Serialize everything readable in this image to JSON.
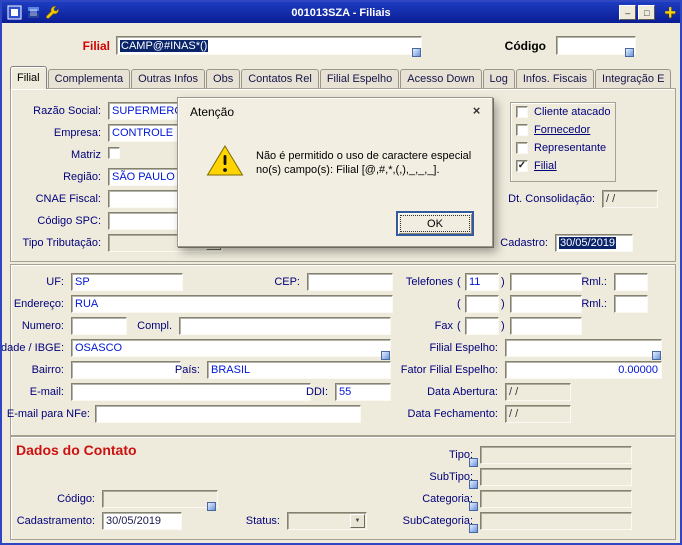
{
  "window": {
    "title": "001013SZA - Filiais"
  },
  "titlebar": {
    "minimize_glyph": "–",
    "maximize_glyph": "□",
    "plus_glyph": "+"
  },
  "glyphs": {
    "dropdown": "▼",
    "check": "✓",
    "paren_open": "(",
    "paren_close": ")"
  },
  "header": {
    "filial_label": "Filial",
    "filial_value": "CAMP@#INAS*()",
    "codigo_label": "Código",
    "codigo_value": ""
  },
  "tabs": [
    "Filial",
    "Complementa",
    "Outras Infos",
    "Obs",
    "Contatos Rel",
    "Filial Espelho",
    "Acesso Down",
    "Log",
    "Infos. Fiscais",
    "Integração E"
  ],
  "form": {
    "razao_social": {
      "label": "Razão Social:",
      "value": "SUPERMERCAD"
    },
    "empresa": {
      "label": "Empresa:",
      "value": "CONTROLE DE"
    },
    "matriz": {
      "label": "Matriz"
    },
    "regiao": {
      "label": "Região:",
      "value": "SÃO PAULO CA"
    },
    "cnae": {
      "label": "CNAE Fiscal:",
      "value": ""
    },
    "codigo_spc": {
      "label": "Código SPC:",
      "value": ""
    },
    "tipo_tributacao": {
      "label": "Tipo Tributação:",
      "value": ""
    },
    "flags": {
      "cliente_atacado": "Cliente atacado",
      "fornecedor": "Fornecedor",
      "representante": "Representante",
      "filial": "Filial"
    },
    "dt_consolidacao": {
      "label": "Dt. Consolidação:",
      "value": "/ /"
    },
    "cadastro": {
      "label": "Cadastro:",
      "value": "30/05/2019"
    }
  },
  "address": {
    "uf": {
      "label": "UF:",
      "value": "SP"
    },
    "cep": {
      "label": "CEP:",
      "value": ""
    },
    "telefones": {
      "label": "Telefones",
      "ddd1": "11",
      "num1": "",
      "ddd2": "",
      "num2": ""
    },
    "rml1": {
      "label": "Rml.:",
      "value": ""
    },
    "rml2": {
      "label": "Rml.:",
      "value": ""
    },
    "endereco": {
      "label": "Endereço:",
      "value": "RUA"
    },
    "numero": {
      "label": "Numero:",
      "value": ""
    },
    "compl": {
      "label": "Compl.",
      "value": ""
    },
    "fax": {
      "label": "Fax",
      "ddd": "",
      "num": ""
    },
    "cidade": {
      "label": "Cidade / IBGE:",
      "value": "OSASCO"
    },
    "filial_espelho": {
      "label": "Filial Espelho:",
      "value": ""
    },
    "bairro": {
      "label": "Bairro:",
      "value": ""
    },
    "pais": {
      "label": "País:",
      "value": "BRASIL"
    },
    "fator_filial_espelho": {
      "label": "Fator Filial Espelho:",
      "value": "0.00000"
    },
    "email": {
      "label": "E-mail:",
      "value": ""
    },
    "ddi": {
      "label": "DDI:",
      "value": "55"
    },
    "data_abertura": {
      "label": "Data Abertura:",
      "value": "/ /"
    },
    "email_nfe": {
      "label": "E-mail para NFe:",
      "value": ""
    },
    "data_fechamento": {
      "label": "Data Fechamento:",
      "value": "/ /"
    }
  },
  "contato": {
    "title": "Dados do Contato",
    "tipo": {
      "label": "Tipo:",
      "value": ""
    },
    "subtipo": {
      "label": "SubTipo:",
      "value": ""
    },
    "codigo": {
      "label": "Código:",
      "value": ""
    },
    "categoria": {
      "label": "Categoria:",
      "value": ""
    },
    "cadastramento": {
      "label": "Cadastramento:",
      "value": "30/05/2019"
    },
    "status": {
      "label": "Status:",
      "value": ""
    },
    "subcategoria": {
      "label": "SubCategoria:",
      "value": ""
    }
  },
  "dialog": {
    "title": "Atenção",
    "close_glyph": "×",
    "message_line1": "Não é permitido o uso de caractere especial",
    "message_line2": "no(s) campo(s): Filial [@,#,*,(,),_,_,_].",
    "ok_label": "OK"
  },
  "colors": {
    "titlebar": "#0a1d94",
    "accent_red": "#d00000",
    "label_navy": "#00007b",
    "value_blue": "#0016d6",
    "selection_navy": "#0a246a",
    "warning_yellow": "#ffd400",
    "background_beige": "#efebdc"
  }
}
